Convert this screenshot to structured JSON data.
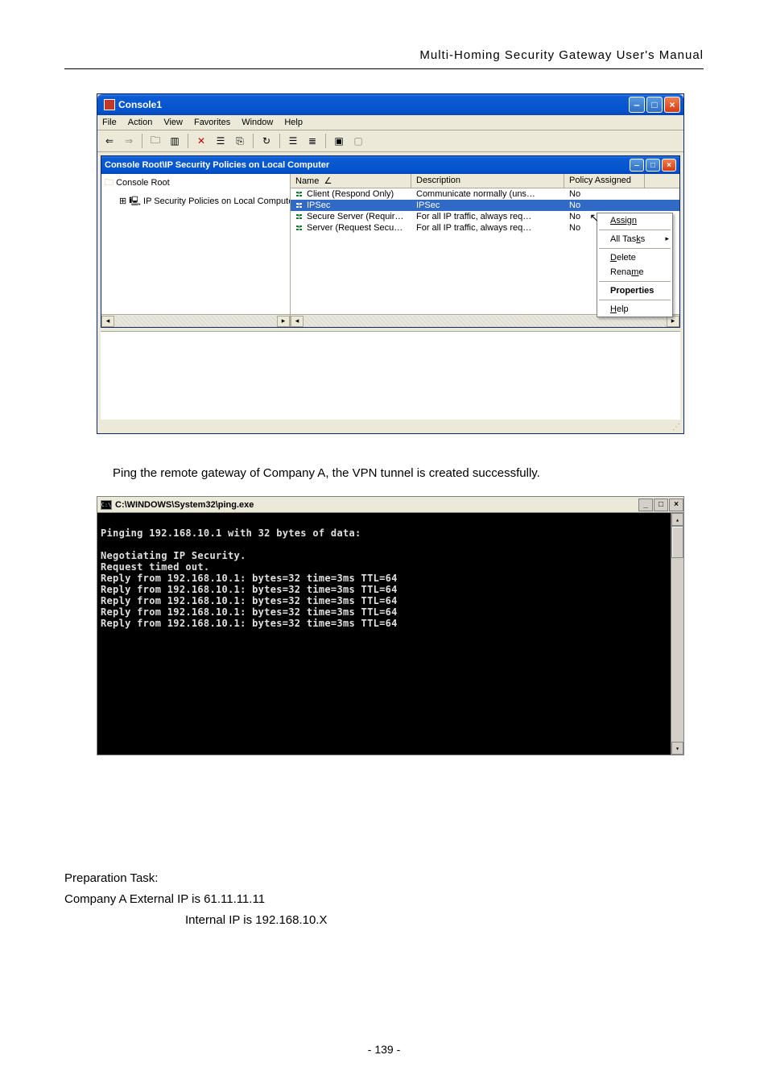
{
  "doc_header": "Multi-Homing Security Gateway User's Manual",
  "console": {
    "window_title": "Console1",
    "menu": [
      "File",
      "Action",
      "View",
      "Favorites",
      "Window",
      "Help"
    ],
    "inner_title": "Console Root\\IP Security Policies on Local Computer",
    "tree": {
      "root": "Console Root",
      "child": "IP Security Policies on Local Compute"
    },
    "columns": {
      "name": "Name",
      "desc": "Description",
      "assigned": "Policy Assigned"
    },
    "rows": [
      {
        "name": "Client (Respond Only)",
        "desc": "Communicate normally (uns…",
        "assigned": "No",
        "selected": false
      },
      {
        "name": "IPSec",
        "desc": "IPSec",
        "assigned": "No",
        "selected": true
      },
      {
        "name": "Secure Server (Requir…",
        "desc": "For all IP traffic, always req…",
        "assigned": "No",
        "selected": false
      },
      {
        "name": "Server (Request Secu…",
        "desc": "For all IP traffic, always req…",
        "assigned": "No",
        "selected": false
      }
    ],
    "context_menu": {
      "assign": "Assign",
      "all_tasks": "All Tasks",
      "delete": "Delete",
      "rename": "Rename",
      "properties": "Properties",
      "help": "Help"
    }
  },
  "paragraph1": "Ping the remote gateway of Company A, the VPN tunnel is created successfully.",
  "cmd": {
    "title": "C:\\WINDOWS\\System32\\ping.exe",
    "lines": [
      "",
      "Pinging 192.168.10.1 with 32 bytes of data:",
      "",
      "Negotiating IP Security.",
      "Request timed out.",
      "Reply from 192.168.10.1: bytes=32 time=3ms TTL=64",
      "Reply from 192.168.10.1: bytes=32 time=3ms TTL=64",
      "Reply from 192.168.10.1: bytes=32 time=3ms TTL=64",
      "Reply from 192.168.10.1: bytes=32 time=3ms TTL=64",
      "Reply from 192.168.10.1: bytes=32 time=3ms TTL=64"
    ]
  },
  "prep": {
    "title": "Preparation Task:",
    "line1": "Company A External IP is 61.11.11.11",
    "line2": "Internal IP is 192.168.10.X"
  },
  "page_number": "- 139 -"
}
